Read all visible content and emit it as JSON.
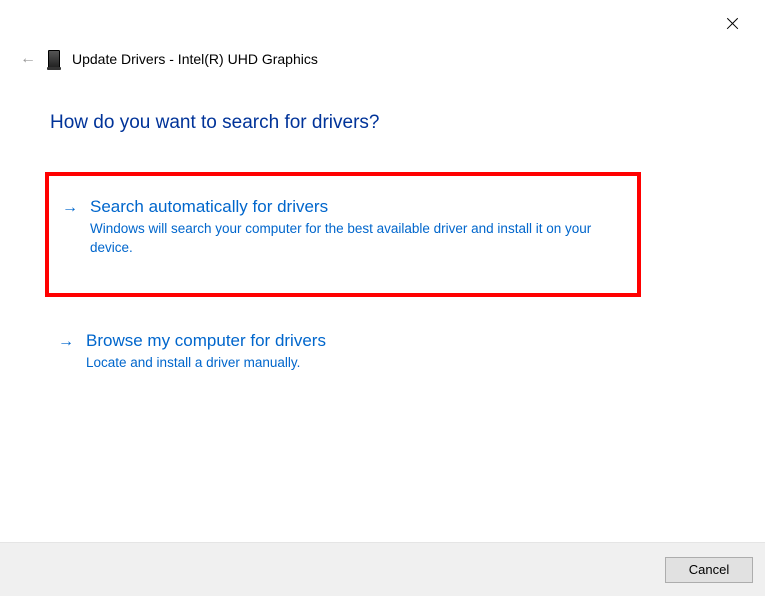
{
  "window": {
    "title": "Update Drivers - Intel(R) UHD Graphics"
  },
  "heading": "How do you want to search for drivers?",
  "options": [
    {
      "title": "Search automatically for drivers",
      "description": "Windows will search your computer for the best available driver and install it on your device."
    },
    {
      "title": "Browse my computer for drivers",
      "description": "Locate and install a driver manually."
    }
  ],
  "buttons": {
    "cancel": "Cancel"
  }
}
